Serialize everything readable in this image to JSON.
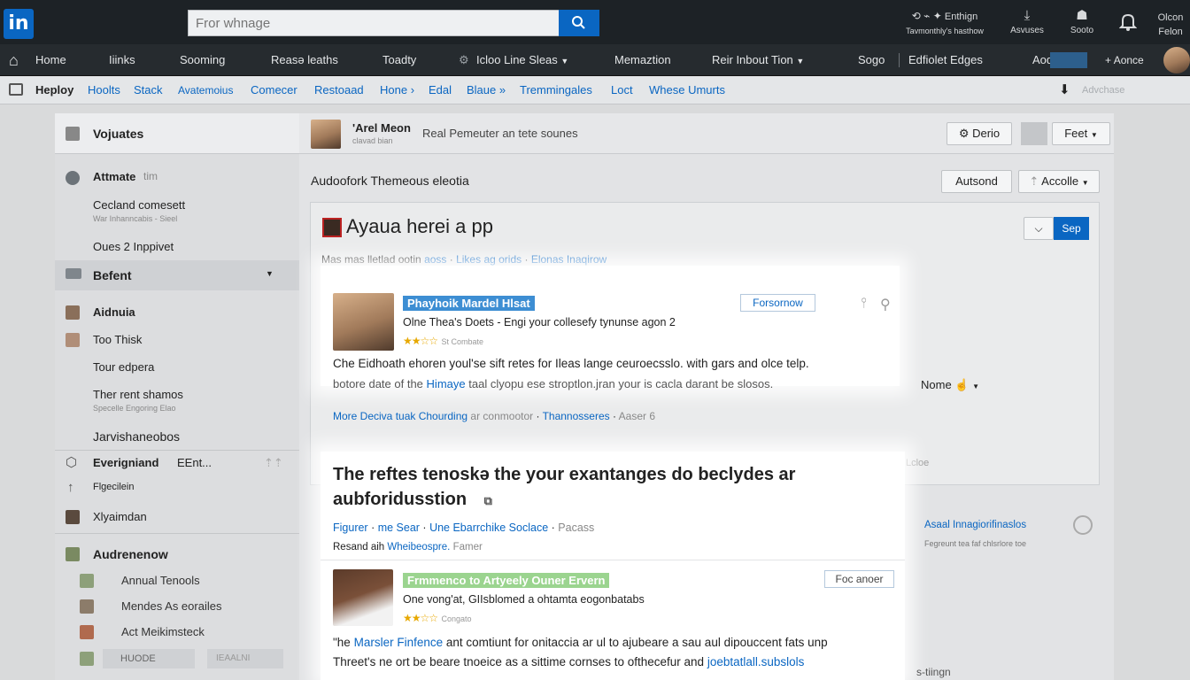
{
  "topbar": {
    "logo": "in",
    "search_placeholder": "Fror whnage",
    "items": [
      {
        "icon": "globe-icon",
        "label_top": "Enthign",
        "label_bottom": "Tavmonthly's hasthow"
      },
      {
        "icon": "download-icon",
        "label_top": "",
        "label_bottom": "Asvuses"
      },
      {
        "icon": "people-icon",
        "label_top": "",
        "label_bottom": "Sooto"
      },
      {
        "icon": "bell-icon",
        "label_top": "",
        "label_bottom": ""
      },
      {
        "icon": "",
        "label_top": "Olcon",
        "label_bottom": "Felon"
      }
    ]
  },
  "nav": {
    "items": [
      "Home",
      "Iiinks",
      "Sooming",
      "Reasə leaths",
      "Toadty",
      "Icloo Line Sleas",
      "Memaztion",
      "Reir Inbout Tion",
      "Sogo",
      "Edfiolet Edges",
      "Aod",
      "Aonce"
    ]
  },
  "linkrow": {
    "title": "Heploy",
    "items": [
      "Hoolts",
      "Stack",
      "Avatemoius",
      "Comecer",
      "Restoaad",
      "Hone",
      "Edal",
      "Blaue",
      "Tremmingales",
      "Loct",
      "Whese Umurts"
    ],
    "right_label": "Advchase"
  },
  "sidebar": {
    "heading": "Vojuates",
    "rows": [
      {
        "label": "Attmate",
        "suffix": "tim",
        "sub": ""
      },
      {
        "label": "Cecland comesett",
        "suffix": "",
        "sub": "War Inhanncabis - Sieel"
      },
      {
        "label": "Oues 2 Inppivet",
        "suffix": "",
        "sub": ""
      },
      {
        "label": "Befent",
        "suffix": "",
        "sub": ""
      },
      {
        "label": "Aidnuia",
        "suffix": "",
        "sub": ""
      },
      {
        "label": "Too Thisk",
        "suffix": "",
        "sub": ""
      },
      {
        "label": "Tour edpera",
        "suffix": "",
        "sub": ""
      },
      {
        "label": "Ther rent shamos",
        "suffix": "",
        "sub": "Specelle Engoring Elao"
      },
      {
        "label": "Jarvishaneobos",
        "suffix": "",
        "sub": ""
      },
      {
        "label": "Everigniand",
        "suffix": "EEnt...",
        "sub": ""
      },
      {
        "label": "Flgecilein",
        "suffix": "",
        "sub": ""
      },
      {
        "label": "Xlyaimdan",
        "suffix": "",
        "sub": ""
      },
      {
        "label": "Audrenenow",
        "suffix": "",
        "sub": ""
      },
      {
        "label": "Annual Tenools",
        "suffix": "",
        "sub": ""
      },
      {
        "label": "Mendes As eorailes",
        "suffix": "",
        "sub": ""
      },
      {
        "label": "Act Meikimsteck",
        "suffix": "",
        "sub": ""
      },
      {
        "label": "HUODE",
        "suffix": "IEAALNI",
        "sub": ""
      }
    ]
  },
  "composer": {
    "name": "'Arel Meon",
    "sub": "clavad bian",
    "text": "Real Pemeuter an tete sounes",
    "btn_delete": "Derio",
    "btn_feet": "Feet"
  },
  "feed": {
    "header": "Audoofork Themeous eleotia",
    "btn_autsond": "Autsond",
    "btn_accolle": "Accolle",
    "post_title": "Ayaua herei a pp",
    "post_btn": "Sep",
    "post_meta_plain": "Mas mas lletlad ootin",
    "post_meta_link1": "aoss",
    "post_meta_link2": "Likes ag orids",
    "post_meta_link3": "Elonas Inaqirow",
    "card1": {
      "name": "Phayhoik Mardel Hlsat",
      "tag": "Forsornow",
      "line1": "Olne Thea's Doets - Engi your collesefy tynunse agon 2",
      "stars": "★★☆☆",
      "stars_text": "St Combate",
      "body1": "Che Eidhoath ehoren youl'se sift retes for Ileas lange ceuroecsslo. with gars and olce telp.",
      "body2_a": "botore date of the",
      "body2_link": "Himaye",
      "body2_b": "taal clyopu ese stroptlon.jran your is cacla darant be slosos."
    },
    "side_label": "Nome",
    "footer_link": "More Deciva tuak Chourding",
    "footer_muted": "ar conmootor",
    "footer_link2": "Thannosseres",
    "footer_muted2": "Aaser 6",
    "side_small": "Lcloe",
    "card2": {
      "title1": "The reftes tenoskə the your exantanges do beclydes ar",
      "title2": "aubforidusstion",
      "meta_link1": "Figurer",
      "meta_link2": "me Sear",
      "meta_link3": "Une Ebarrchike Soclace",
      "meta_plain": "Pacass",
      "meta2_plain": "Resand aih",
      "meta2_link": "Wheibeospre.",
      "meta2_muted": "Famer",
      "name": "Frmmenco to Artyeely Ouner Ervern",
      "tag": "Foc anoer",
      "line1": "One vong'at, GIIsblomed a ohtamta eogonbatabs",
      "stars": "★★☆☆",
      "stars_text": "Congato",
      "body1_a": "\"he",
      "body1_link": "Marsler Finfence",
      "body1_b": "ant comtiunt for onitaccia ar ul to ajubeare a sau aul dipouccent fats unp",
      "body2_a": "Threet's ne ort be beare tnoeice as a sittime cornses to ofthecefur and",
      "body2_link": "joebtatlall.subslols"
    },
    "right_link": "Asaal Innagiorifinaslos",
    "right_muted": "Fegreunt tea faf chlsrlore toe",
    "right_bottom": "s-tiingn"
  }
}
